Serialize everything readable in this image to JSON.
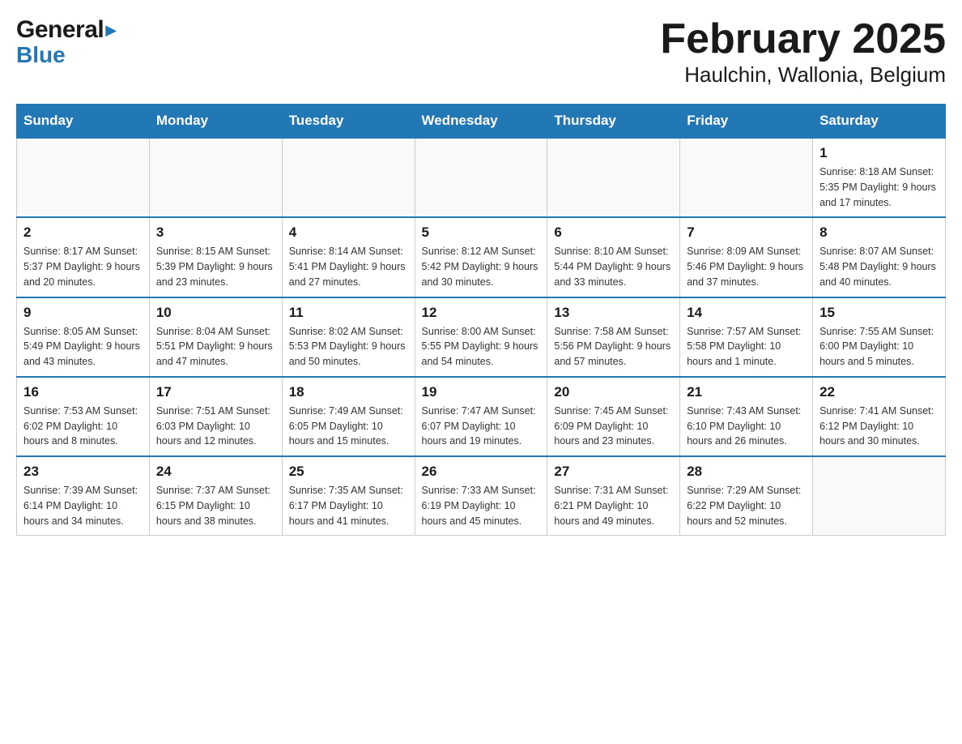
{
  "header": {
    "logo_general": "General",
    "logo_blue": "Blue",
    "month_title": "February 2025",
    "location": "Haulchin, Wallonia, Belgium"
  },
  "weekdays": [
    "Sunday",
    "Monday",
    "Tuesday",
    "Wednesday",
    "Thursday",
    "Friday",
    "Saturday"
  ],
  "weeks": [
    {
      "days": [
        {
          "number": "",
          "info": ""
        },
        {
          "number": "",
          "info": ""
        },
        {
          "number": "",
          "info": ""
        },
        {
          "number": "",
          "info": ""
        },
        {
          "number": "",
          "info": ""
        },
        {
          "number": "",
          "info": ""
        },
        {
          "number": "1",
          "info": "Sunrise: 8:18 AM\nSunset: 5:35 PM\nDaylight: 9 hours and 17 minutes."
        }
      ]
    },
    {
      "days": [
        {
          "number": "2",
          "info": "Sunrise: 8:17 AM\nSunset: 5:37 PM\nDaylight: 9 hours and 20 minutes."
        },
        {
          "number": "3",
          "info": "Sunrise: 8:15 AM\nSunset: 5:39 PM\nDaylight: 9 hours and 23 minutes."
        },
        {
          "number": "4",
          "info": "Sunrise: 8:14 AM\nSunset: 5:41 PM\nDaylight: 9 hours and 27 minutes."
        },
        {
          "number": "5",
          "info": "Sunrise: 8:12 AM\nSunset: 5:42 PM\nDaylight: 9 hours and 30 minutes."
        },
        {
          "number": "6",
          "info": "Sunrise: 8:10 AM\nSunset: 5:44 PM\nDaylight: 9 hours and 33 minutes."
        },
        {
          "number": "7",
          "info": "Sunrise: 8:09 AM\nSunset: 5:46 PM\nDaylight: 9 hours and 37 minutes."
        },
        {
          "number": "8",
          "info": "Sunrise: 8:07 AM\nSunset: 5:48 PM\nDaylight: 9 hours and 40 minutes."
        }
      ]
    },
    {
      "days": [
        {
          "number": "9",
          "info": "Sunrise: 8:05 AM\nSunset: 5:49 PM\nDaylight: 9 hours and 43 minutes."
        },
        {
          "number": "10",
          "info": "Sunrise: 8:04 AM\nSunset: 5:51 PM\nDaylight: 9 hours and 47 minutes."
        },
        {
          "number": "11",
          "info": "Sunrise: 8:02 AM\nSunset: 5:53 PM\nDaylight: 9 hours and 50 minutes."
        },
        {
          "number": "12",
          "info": "Sunrise: 8:00 AM\nSunset: 5:55 PM\nDaylight: 9 hours and 54 minutes."
        },
        {
          "number": "13",
          "info": "Sunrise: 7:58 AM\nSunset: 5:56 PM\nDaylight: 9 hours and 57 minutes."
        },
        {
          "number": "14",
          "info": "Sunrise: 7:57 AM\nSunset: 5:58 PM\nDaylight: 10 hours and 1 minute."
        },
        {
          "number": "15",
          "info": "Sunrise: 7:55 AM\nSunset: 6:00 PM\nDaylight: 10 hours and 5 minutes."
        }
      ]
    },
    {
      "days": [
        {
          "number": "16",
          "info": "Sunrise: 7:53 AM\nSunset: 6:02 PM\nDaylight: 10 hours and 8 minutes."
        },
        {
          "number": "17",
          "info": "Sunrise: 7:51 AM\nSunset: 6:03 PM\nDaylight: 10 hours and 12 minutes."
        },
        {
          "number": "18",
          "info": "Sunrise: 7:49 AM\nSunset: 6:05 PM\nDaylight: 10 hours and 15 minutes."
        },
        {
          "number": "19",
          "info": "Sunrise: 7:47 AM\nSunset: 6:07 PM\nDaylight: 10 hours and 19 minutes."
        },
        {
          "number": "20",
          "info": "Sunrise: 7:45 AM\nSunset: 6:09 PM\nDaylight: 10 hours and 23 minutes."
        },
        {
          "number": "21",
          "info": "Sunrise: 7:43 AM\nSunset: 6:10 PM\nDaylight: 10 hours and 26 minutes."
        },
        {
          "number": "22",
          "info": "Sunrise: 7:41 AM\nSunset: 6:12 PM\nDaylight: 10 hours and 30 minutes."
        }
      ]
    },
    {
      "days": [
        {
          "number": "23",
          "info": "Sunrise: 7:39 AM\nSunset: 6:14 PM\nDaylight: 10 hours and 34 minutes."
        },
        {
          "number": "24",
          "info": "Sunrise: 7:37 AM\nSunset: 6:15 PM\nDaylight: 10 hours and 38 minutes."
        },
        {
          "number": "25",
          "info": "Sunrise: 7:35 AM\nSunset: 6:17 PM\nDaylight: 10 hours and 41 minutes."
        },
        {
          "number": "26",
          "info": "Sunrise: 7:33 AM\nSunset: 6:19 PM\nDaylight: 10 hours and 45 minutes."
        },
        {
          "number": "27",
          "info": "Sunrise: 7:31 AM\nSunset: 6:21 PM\nDaylight: 10 hours and 49 minutes."
        },
        {
          "number": "28",
          "info": "Sunrise: 7:29 AM\nSunset: 6:22 PM\nDaylight: 10 hours and 52 minutes."
        },
        {
          "number": "",
          "info": ""
        }
      ]
    }
  ]
}
